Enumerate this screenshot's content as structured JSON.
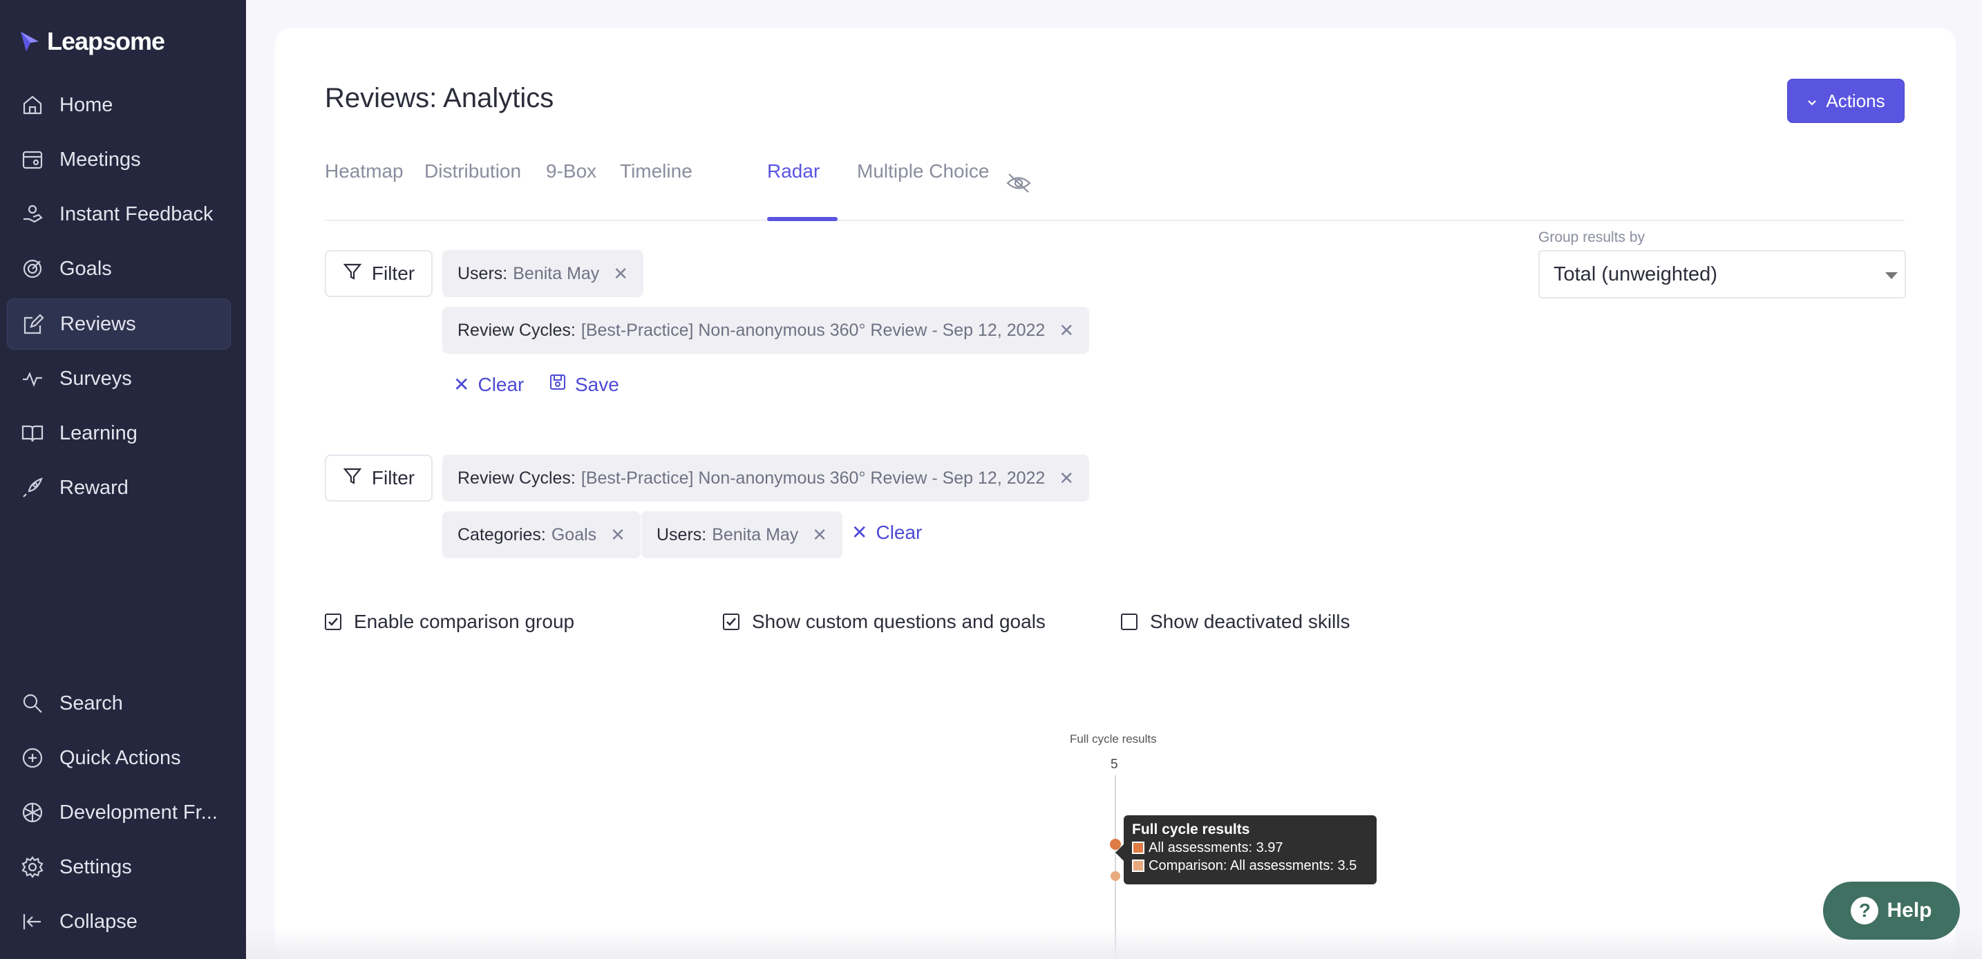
{
  "brand": {
    "name": "Leapsome"
  },
  "sidebar": {
    "items": [
      {
        "label": "Home",
        "icon": "home-icon"
      },
      {
        "label": "Meetings",
        "icon": "meetings-icon"
      },
      {
        "label": "Instant Feedback",
        "icon": "feedback-icon"
      },
      {
        "label": "Goals",
        "icon": "goals-icon"
      },
      {
        "label": "Reviews",
        "icon": "reviews-icon",
        "active": true
      },
      {
        "label": "Surveys",
        "icon": "surveys-icon"
      },
      {
        "label": "Learning",
        "icon": "learning-icon"
      },
      {
        "label": "Reward",
        "icon": "reward-icon"
      }
    ],
    "bottom_items": [
      {
        "label": "Search",
        "icon": "search-icon"
      },
      {
        "label": "Quick Actions",
        "icon": "plus-circle-icon"
      },
      {
        "label": "Development Fr...",
        "icon": "framework-icon"
      },
      {
        "label": "Settings",
        "icon": "gear-icon"
      },
      {
        "label": "Collapse",
        "icon": "collapse-icon"
      }
    ]
  },
  "header": {
    "title": "Reviews: Analytics",
    "actions_label": "Actions"
  },
  "tabs": [
    {
      "label": "Heatmap"
    },
    {
      "label": "Distribution"
    },
    {
      "label": "9-Box"
    },
    {
      "label": "Timeline"
    },
    {
      "label": "Radar",
      "active": true
    },
    {
      "label": "Multiple Choice"
    }
  ],
  "filters": {
    "filter_label": "Filter",
    "group1": {
      "users_key": "Users:",
      "users_val": "Benita May",
      "cycles_key": "Review Cycles:",
      "cycles_val": "[Best-Practice] Non-anonymous 360° Review - Sep 12, 2022",
      "clear_label": "Clear",
      "save_label": "Save"
    },
    "group2": {
      "cycles_key": "Review Cycles:",
      "cycles_val": "[Best-Practice] Non-anonymous 360° Review - Sep 12, 2022",
      "categories_key": "Categories:",
      "categories_val": "Goals",
      "users_key": "Users:",
      "users_val": "Benita May",
      "clear_label": "Clear"
    }
  },
  "group_by": {
    "label": "Group results by",
    "value": "Total (unweighted)"
  },
  "options": [
    {
      "label": "Enable comparison group",
      "checked": true
    },
    {
      "label": "Show custom questions and goals",
      "checked": true
    },
    {
      "label": "Show deactivated skills",
      "checked": false
    }
  ],
  "chart_data": {
    "type": "radar",
    "axis_label": "Full cycle results",
    "axis_max": "5",
    "series": [
      {
        "name": "All assessments",
        "value": 3.97,
        "color": "#e07b45"
      },
      {
        "name": "Comparison: All assessments",
        "value": 3.5,
        "color": "#e8a97e"
      }
    ],
    "tooltip": {
      "title": "Full cycle results",
      "rows": [
        "All assessments: 3.97",
        "Comparison: All assessments: 3.5"
      ]
    }
  },
  "help": {
    "label": "Help"
  },
  "colors": {
    "accent": "#5a55e0",
    "sidebar": "#24273d",
    "help": "#3f7061"
  }
}
